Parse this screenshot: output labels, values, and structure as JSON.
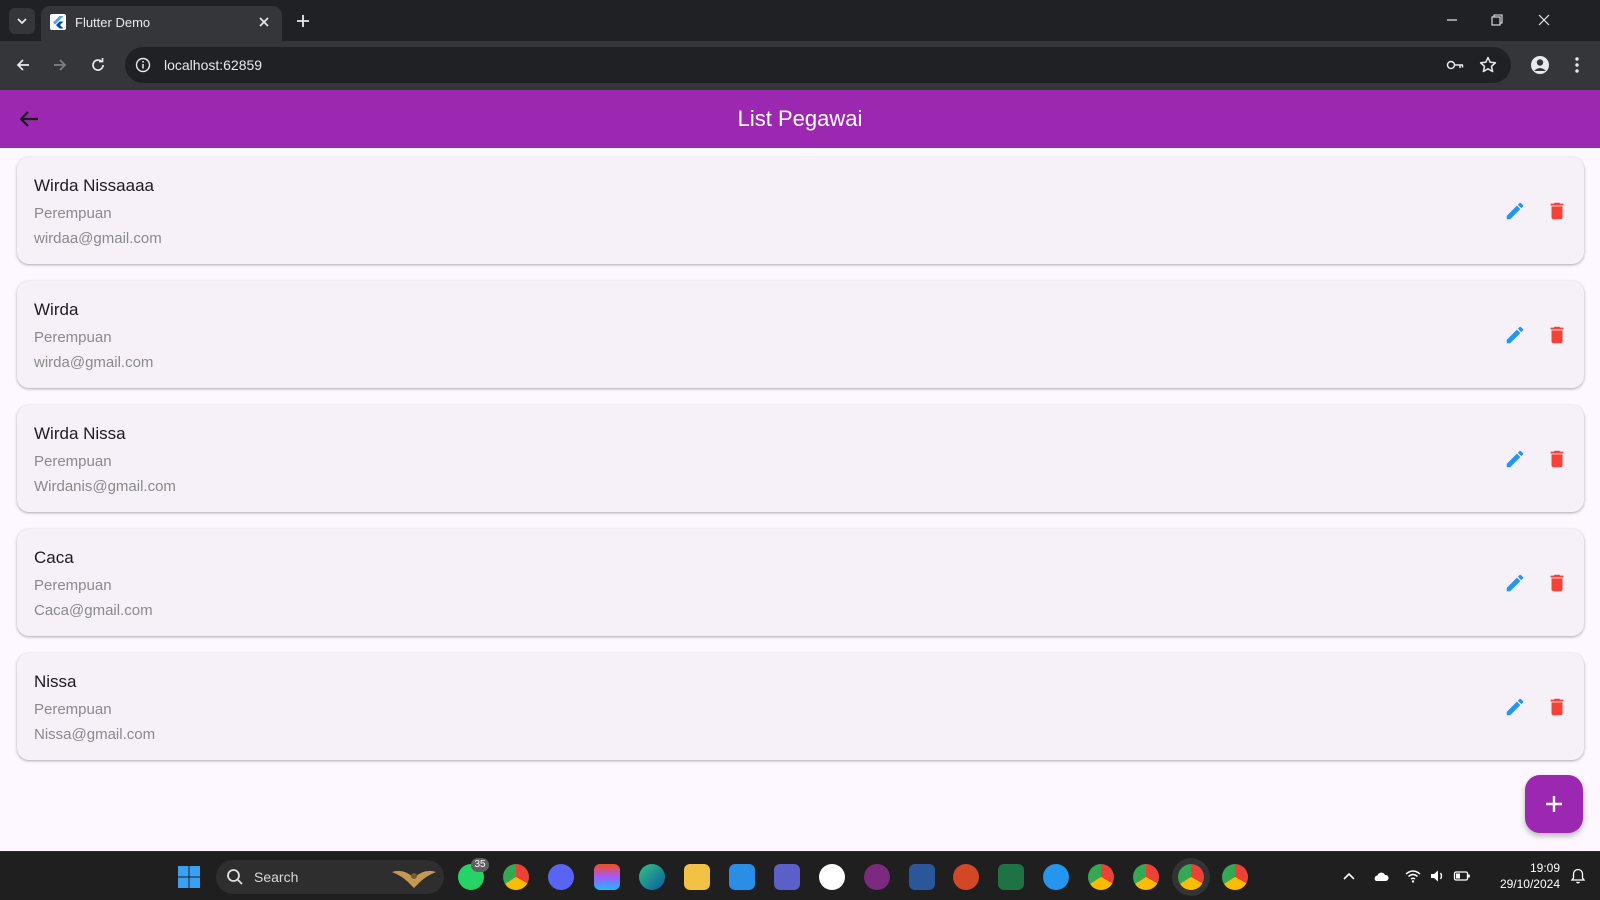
{
  "browser": {
    "tab": {
      "title": "Flutter Demo",
      "favicon": "flutter-logo"
    },
    "url": "localhost:62859"
  },
  "app": {
    "title": "List Pegawai",
    "primary_color": "#9c27b0",
    "edit_color": "#2196f3",
    "delete_color": "#f44336",
    "employees": [
      {
        "name": "Wirda Nissaaaa",
        "gender": "Perempuan",
        "email": "wirdaa@gmail.com"
      },
      {
        "name": "Wirda",
        "gender": "Perempuan",
        "email": "wirda@gmail.com"
      },
      {
        "name": "Wirda Nissa",
        "gender": "Perempuan",
        "email": "Wirdanis@gmail.com"
      },
      {
        "name": "Caca",
        "gender": "Perempuan",
        "email": "Caca@gmail.com"
      },
      {
        "name": "Nissa",
        "gender": "Perempuan",
        "email": "Nissa@gmail.com"
      }
    ],
    "fab_icon": "add-icon"
  },
  "taskbar": {
    "search_label": "Search",
    "whatsapp_badge": "35",
    "time": "19:09",
    "date": "29/10/2024"
  }
}
